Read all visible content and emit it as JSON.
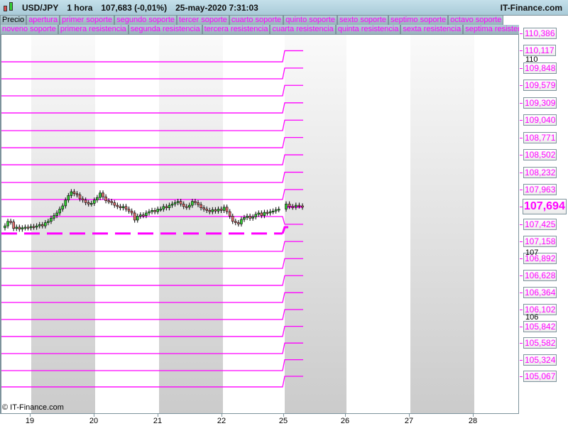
{
  "header": {
    "symbol": "USD/JPY",
    "timeframe": "1 hora",
    "quote": "107,683 (-0,01%)",
    "datetime": "25-may-2020 7:31:03",
    "brand": "IT-Finance.com"
  },
  "legend_row1": [
    "Precio",
    "apertura",
    "primer soporte",
    "segundo soporte",
    "tercer soporte",
    "cuarto soporte",
    "quinto soporte",
    "sexto soporte",
    "septimo soporte",
    "octavo soporte"
  ],
  "legend_row2": [
    "noveno soporte",
    "primera resistencia",
    "segunda resistencia",
    "tercera resistencia",
    "cuarta resistencia",
    "quinta resistencia",
    "sexta resistencia",
    "septima resistencia"
  ],
  "copyright": "© IT-Finance.com",
  "axis": {
    "current_price": "107,694",
    "level_labels": [
      "110,386",
      "110,117",
      "109,848",
      "109,579",
      "109,309",
      "109,040",
      "108,771",
      "108,502",
      "108,232",
      "107,963",
      "107,425",
      "107,158",
      "106,892",
      "106,628",
      "106,364",
      "106,102",
      "105,842",
      "105,582",
      "105,324",
      "105,067"
    ],
    "round_ticks": [
      "110",
      "107",
      "106"
    ]
  },
  "x_labels": [
    "19",
    "20",
    "21",
    "22",
    "25",
    "26",
    "27",
    "28"
  ],
  "colors": {
    "level": "#ff00ff",
    "up": "#33cc33",
    "down": "#e07070"
  },
  "chart_data": {
    "type": "candlestick",
    "ylim": [
      104.8,
      110.4
    ],
    "current_price": 107.694,
    "levels_current": [
      110.386,
      110.117,
      109.848,
      109.579,
      109.309,
      109.04,
      108.771,
      108.502,
      108.232,
      107.963,
      107.425,
      107.158,
      106.892,
      106.628,
      106.364,
      106.102,
      105.842,
      105.582,
      105.324,
      105.067
    ],
    "levels_previous": [
      110.43,
      109.945,
      109.681,
      109.417,
      109.152,
      108.877,
      108.612,
      108.348,
      108.073,
      107.809,
      107.545,
      107.005,
      106.741,
      106.477,
      106.212,
      105.948,
      105.684,
      105.419,
      105.155,
      104.902
    ],
    "opening_previous": 107.281,
    "opening_current": 107.38,
    "closes_past": [
      107.4,
      107.47,
      107.46,
      107.36,
      107.38,
      107.35,
      107.37,
      107.38,
      107.37,
      107.39,
      107.38,
      107.4,
      107.42,
      107.4,
      107.45,
      107.47,
      107.52,
      107.56,
      107.6,
      107.66,
      107.71,
      107.8,
      107.87,
      107.93,
      107.9,
      107.88,
      107.82,
      107.8,
      107.76,
      107.74,
      107.75,
      107.8,
      107.84,
      107.91,
      107.85,
      107.79,
      107.78,
      107.76,
      107.72,
      107.7,
      107.68,
      107.7,
      107.66,
      107.63,
      107.6,
      107.49,
      107.55,
      107.57,
      107.56,
      107.6,
      107.62,
      107.64,
      107.62,
      107.66,
      107.66,
      107.7,
      107.68,
      107.72,
      107.74,
      107.76,
      107.78,
      107.74,
      107.7,
      107.69,
      107.72,
      107.78,
      107.76,
      107.73,
      107.68,
      107.66,
      107.64,
      107.62,
      107.65,
      107.63,
      107.66,
      107.64,
      107.69,
      107.62,
      107.55,
      107.47,
      107.45,
      107.43,
      107.5,
      107.53,
      107.55,
      107.52,
      107.54,
      107.58,
      107.6,
      107.56,
      107.61,
      107.6,
      107.62,
      107.63,
      107.65,
      107.66
    ],
    "closes_current": [
      107.74,
      107.7,
      107.69,
      107.72,
      107.71,
      107.69
    ]
  }
}
